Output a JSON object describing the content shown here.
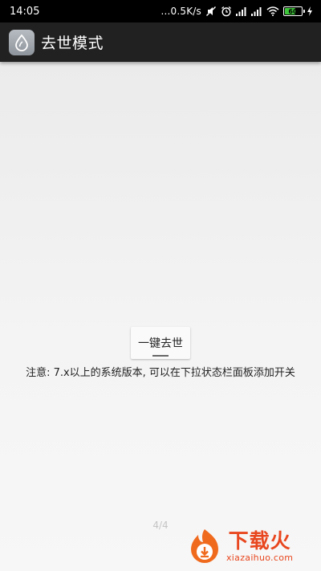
{
  "status_bar": {
    "time": "14:05",
    "network_speed": "...0.5K/s",
    "icons": [
      "mute-icon",
      "alarm-icon",
      "signal-icon",
      "signal-icon",
      "wifi-icon",
      "battery-icon",
      "charging-icon"
    ],
    "battery_level": "60",
    "battery_color": "#3ec63a"
  },
  "app_bar": {
    "title": "去世模式",
    "icon": "drop-icon"
  },
  "main": {
    "button_label": "一键去世",
    "note": "注意: 7.x以上的系统版本, 可以在下拉状态栏面板添加开关",
    "page_indicator": "4/4"
  },
  "watermark": {
    "text": "下载火",
    "subtext": "xiazaihuo.com",
    "color": "#e8471f"
  }
}
